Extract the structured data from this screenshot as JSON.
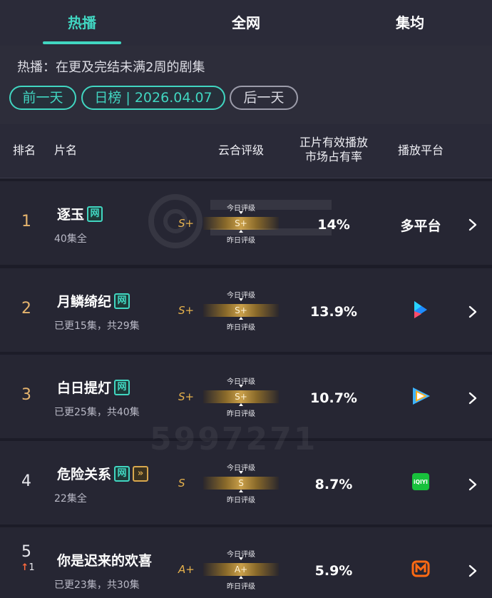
{
  "tabs": [
    {
      "label": "热播",
      "active": true
    },
    {
      "label": "全网",
      "active": false
    },
    {
      "label": "集均",
      "active": false
    }
  ],
  "description": "热播：在更及完结未满2周的剧集",
  "date_nav": {
    "prev": "前一天",
    "current": "日榜 | 2026.04.07",
    "next": "后一天"
  },
  "table_header": {
    "rank": "排名",
    "name": "片名",
    "rating": "云合评级",
    "share": "正片有效播放\n市场占有率",
    "platform": "播放平台"
  },
  "rating_labels": {
    "today": "今日评级",
    "yesterday": "昨日评级"
  },
  "rows": [
    {
      "rank": "1",
      "title": "逐玉",
      "tags": [
        "网"
      ],
      "sub": "40集全",
      "grade": "S+",
      "today_grade": "S+",
      "share": "14%",
      "platform": "多平台",
      "platform_icon": "multi-platform",
      "rank_change": ""
    },
    {
      "rank": "2",
      "title": "月鳞绮纪",
      "tags": [
        "网"
      ],
      "sub": "已更15集，共29集",
      "grade": "S+",
      "today_grade": "S+",
      "share": "13.9%",
      "platform": "",
      "platform_icon": "youku-icon",
      "rank_change": ""
    },
    {
      "rank": "3",
      "title": "白日提灯",
      "tags": [
        "网"
      ],
      "sub": "已更25集，共40集",
      "grade": "S+",
      "today_grade": "S+",
      "share": "10.7%",
      "platform": "",
      "platform_icon": "tencent-video-icon",
      "rank_change": ""
    },
    {
      "rank": "4",
      "title": "危险关系",
      "tags": [
        "网",
        "»"
      ],
      "sub": "22集全",
      "grade": "S",
      "today_grade": "S",
      "share": "8.7%",
      "platform": "",
      "platform_icon": "iqiyi-icon",
      "rank_change": ""
    },
    {
      "rank": "5",
      "title": "你是迟来的欢喜",
      "tags": [],
      "sub": "已更23集，共30集",
      "grade": "A+",
      "today_grade": "A+",
      "share": "5.9%",
      "platform": "",
      "platform_icon": "mango-tv-icon",
      "rank_change": "1"
    }
  ],
  "watermark_text": "5997271",
  "colors": {
    "accent": "#41d6c1",
    "rank": "#e5b46e",
    "grade": "#e7b24c",
    "background": "#1c1c28"
  }
}
